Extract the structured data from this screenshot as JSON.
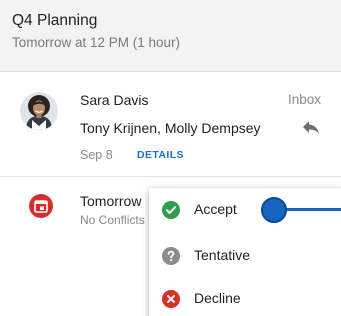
{
  "event": {
    "title": "Q4 Planning",
    "time": "Tomorrow at 12 PM (1 hour)"
  },
  "message": {
    "sender": "Sara Davis",
    "folder": "Inbox",
    "recipients": "Tony Krijnen, Molly Dempsey",
    "date": "Sep 8",
    "details_label": "DETAILS"
  },
  "calendar": {
    "title": "Tomorrow",
    "subtitle": "No Conflicts"
  },
  "rsvp_menu": {
    "items": [
      {
        "label": "Accept",
        "icon": "check-circle-icon",
        "color": "#2e9e4a"
      },
      {
        "label": "Tentative",
        "icon": "question-circle-icon",
        "color": "#8c8c8c"
      },
      {
        "label": "Decline",
        "icon": "x-circle-icon",
        "color": "#d93025"
      }
    ]
  },
  "colors": {
    "accent": "#1a73c8",
    "calendar_red": "#d32f2f",
    "pointer": "#1565c0"
  }
}
